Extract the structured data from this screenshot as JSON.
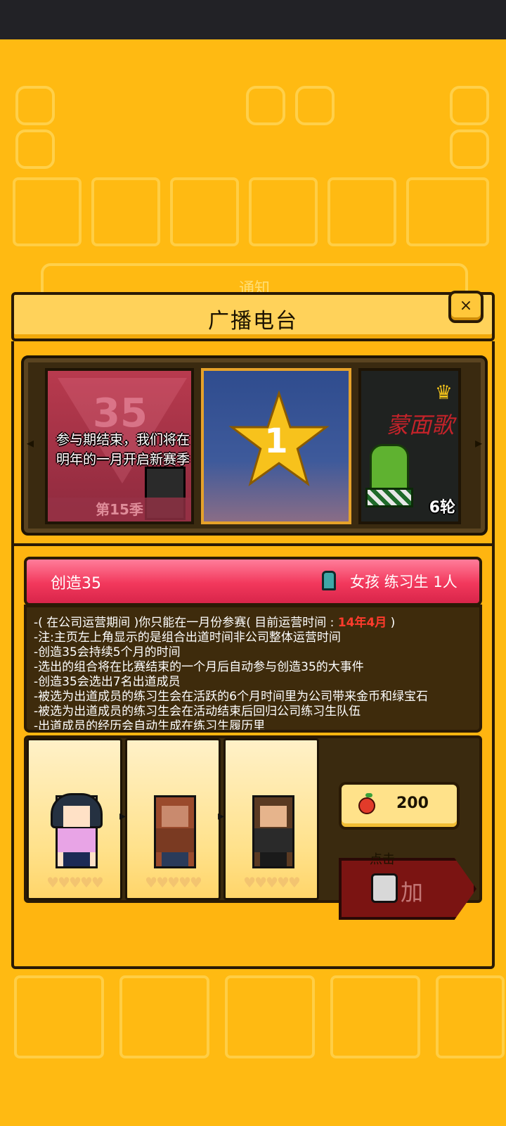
{
  "background": {
    "notice_label": "通知"
  },
  "dialog": {
    "title": "广播电台",
    "close_label": "×"
  },
  "carousel": {
    "left_arrow": "◂",
    "right_arrow": "▸",
    "slides": [
      {
        "number": "35",
        "text_line1": "参与期结束，我们将在",
        "text_line2": "明年的一月开启新赛季",
        "season": "第15季"
      },
      {
        "number": "1"
      },
      {
        "title": "蒙面歌",
        "round": "6轮"
      }
    ]
  },
  "event": {
    "title": "创造35",
    "requirement": "女孩 练习生 1人"
  },
  "description": {
    "line1_prefix": "-( 在公司运营期间 )你只能在一月份参赛( 目前运营时间 : ",
    "line1_highlight": "14年4月",
    "line1_suffix": " )",
    "line2": "-注:主页左上角显示的是组合出道时间非公司整体运营时间",
    "line3": "-创造35会持续5个月的时间",
    "line4": "-选出的组合将在比赛结束的一个月后自动参与创造35的大事件",
    "line5": "-创造35会选出7名出道成员",
    "line6": "-被选为出道成员的练习生会在活跃的6个月时间里为公司带来金币和绿宝石",
    "line7": "-被选为出道成员的练习生会在活动结束后回归公司练习生队伍",
    "line8": "-出道成员的经历会自动生成在练习生履历里"
  },
  "trainees": {
    "hearts": "♥♥♥♥♥",
    "arrow": "▸"
  },
  "cost": {
    "apples": "200"
  },
  "join": {
    "hint": "点击",
    "label": "加"
  },
  "colors": {
    "background": "#FFBA12",
    "event_bar": "#F2385C",
    "highlight": "#FF3B2C",
    "join_button": "#7B1412"
  }
}
